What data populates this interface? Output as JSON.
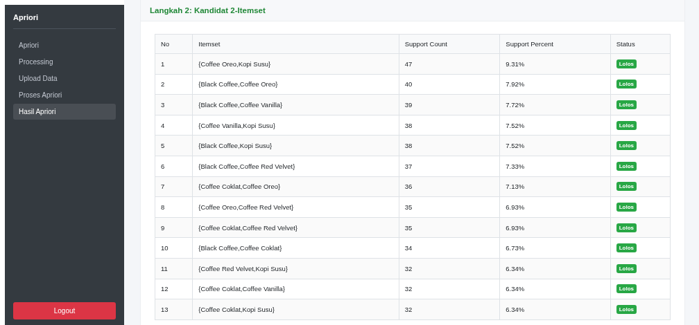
{
  "sidebar": {
    "title": "Apriori",
    "items": [
      {
        "label": "Apriori",
        "selected": false
      },
      {
        "label": "Processing",
        "selected": false
      },
      {
        "label": "Upload Data",
        "selected": false
      },
      {
        "label": "Proses Apriori",
        "selected": false
      },
      {
        "label": "Hasil Apriori",
        "selected": true
      }
    ],
    "logout": "Logout"
  },
  "card": {
    "title": "Langkah 2: Kandidat 2-Itemset",
    "table": {
      "columns": [
        "No",
        "Itemset",
        "Support Count",
        "Support Percent",
        "Status"
      ],
      "rows": [
        {
          "no": "1",
          "itemset": "{Coffee Oreo,Kopi Susu}",
          "count": "47",
          "percent": "9.31%",
          "status": {
            "label": "Lolos",
            "passed": true
          }
        },
        {
          "no": "2",
          "itemset": "{Black Coffee,Coffee Oreo}",
          "count": "40",
          "percent": "7.92%",
          "status": {
            "label": "Lolos",
            "passed": true
          }
        },
        {
          "no": "3",
          "itemset": "{Black Coffee,Coffee Vanilla}",
          "count": "39",
          "percent": "7.72%",
          "status": {
            "label": "Lolos",
            "passed": true
          }
        },
        {
          "no": "4",
          "itemset": "{Coffee Vanilla,Kopi Susu}",
          "count": "38",
          "percent": "7.52%",
          "status": {
            "label": "Lolos",
            "passed": true
          }
        },
        {
          "no": "5",
          "itemset": "{Black Coffee,Kopi Susu}",
          "count": "38",
          "percent": "7.52%",
          "status": {
            "label": "Lolos",
            "passed": true
          }
        },
        {
          "no": "6",
          "itemset": "{Black Coffee,Coffee Red Velvet}",
          "count": "37",
          "percent": "7.33%",
          "status": {
            "label": "Lolos",
            "passed": true
          }
        },
        {
          "no": "7",
          "itemset": "{Coffee Coklat,Coffee Oreo}",
          "count": "36",
          "percent": "7.13%",
          "status": {
            "label": "Lolos",
            "passed": true
          }
        },
        {
          "no": "8",
          "itemset": "{Coffee Oreo,Coffee Red Velvet}",
          "count": "35",
          "percent": "6.93%",
          "status": {
            "label": "Lolos",
            "passed": true
          }
        },
        {
          "no": "9",
          "itemset": "{Coffee Coklat,Coffee Red Velvet}",
          "count": "35",
          "percent": "6.93%",
          "status": {
            "label": "Lolos",
            "passed": true
          }
        },
        {
          "no": "10",
          "itemset": "{Black Coffee,Coffee Coklat}",
          "count": "34",
          "percent": "6.73%",
          "status": {
            "label": "Lolos",
            "passed": true
          }
        },
        {
          "no": "11",
          "itemset": "{Coffee Red Velvet,Kopi Susu}",
          "count": "32",
          "percent": "6.34%",
          "status": {
            "label": "Lolos",
            "passed": true
          }
        },
        {
          "no": "12",
          "itemset": "{Coffee Coklat,Coffee Vanilla}",
          "count": "32",
          "percent": "6.34%",
          "status": {
            "label": "Lolos",
            "passed": true
          }
        },
        {
          "no": "13",
          "itemset": "{Coffee Coklat,Kopi Susu}",
          "count": "32",
          "percent": "6.34%",
          "status": {
            "label": "Lolos",
            "passed": true
          }
        }
      ]
    }
  }
}
